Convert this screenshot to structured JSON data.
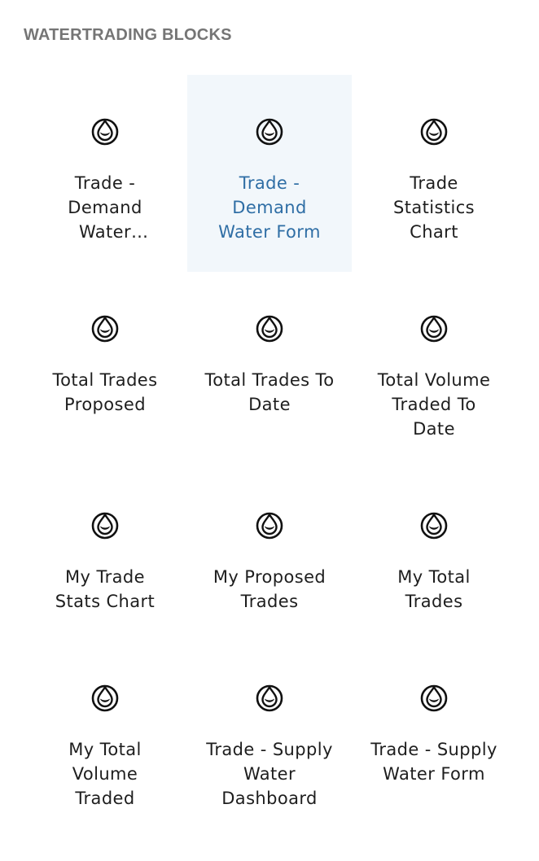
{
  "section": {
    "title": "WATERTRADING BLOCKS"
  },
  "blocks": [
    {
      "label": "Trade - Demand Water Dashboard",
      "icon": "water-drop-icon",
      "selected": false,
      "truncated": true
    },
    {
      "label": "Trade - Demand Water Form",
      "icon": "water-drop-icon",
      "selected": true,
      "truncated": false
    },
    {
      "label": "Trade Statistics Chart",
      "icon": "water-drop-icon",
      "selected": false,
      "truncated": false
    },
    {
      "label": "Total Trades Proposed",
      "icon": "water-drop-icon",
      "selected": false,
      "truncated": false
    },
    {
      "label": "Total Trades To Date",
      "icon": "water-drop-icon",
      "selected": false,
      "truncated": false
    },
    {
      "label": "Total Volume Traded To Date",
      "icon": "water-drop-icon",
      "selected": false,
      "truncated": false
    },
    {
      "label": "My Trade Stats Chart",
      "icon": "water-drop-icon",
      "selected": false,
      "truncated": false
    },
    {
      "label": "My Proposed Trades",
      "icon": "water-drop-icon",
      "selected": false,
      "truncated": false
    },
    {
      "label": "My Total Trades",
      "icon": "water-drop-icon",
      "selected": false,
      "truncated": false
    },
    {
      "label": "My Total Volume Traded",
      "icon": "water-drop-icon",
      "selected": false,
      "truncated": false
    },
    {
      "label": "Trade - Supply Water Dashboard",
      "icon": "water-drop-icon",
      "selected": false,
      "truncated": false
    },
    {
      "label": "Trade - Supply Water Form",
      "icon": "water-drop-icon",
      "selected": false,
      "truncated": false
    }
  ],
  "colors": {
    "selected_background": "#f2f7fb",
    "selected_text": "#2f6ea5",
    "heading_text": "#757575"
  }
}
